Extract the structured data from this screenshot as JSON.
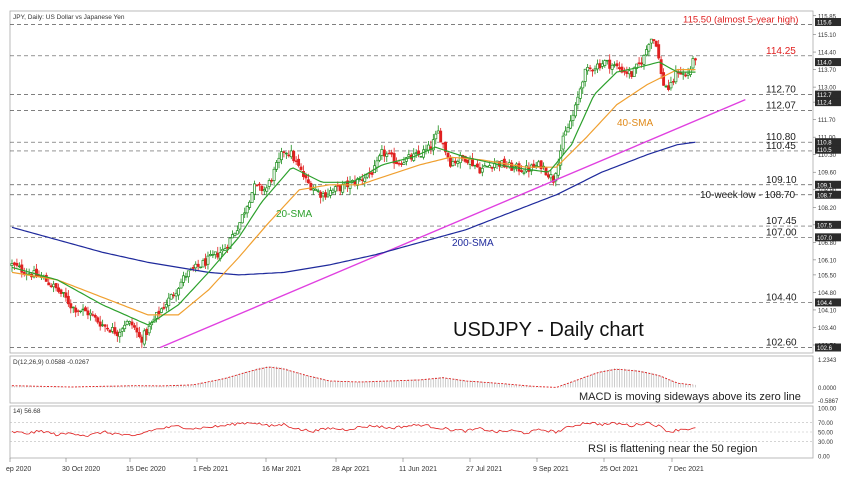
{
  "header": {
    "symbol_line": "JPY, Daily:  US Dollar vs Japanese Yen",
    "macd_line": "D(12,26,9) 0.0588 -0.0267",
    "rsi_line": "14) 56.68"
  },
  "annotations": {
    "main_title": "USDJPY - Daily chart",
    "sma20": "20-SMA",
    "sma40": "40-SMA",
    "sma200": "200-SMA",
    "high_label": "115.50 (almost 5-year high)",
    "low_label": "10-week low - 108.70",
    "macd_note": "MACD is moving sideways above its zero line",
    "rsi_note": "RSI is flattening near the 50 region"
  },
  "colors": {
    "up_candle": "#1a8c1a",
    "down_candle": "#e02020",
    "sma20": "#2ca02c",
    "sma40": "#f0a030",
    "sma200": "#1f2a9c",
    "trendline": "#e040e0",
    "level_highlight": "#e02020",
    "macd": "#e02020",
    "rsi": "#e02020"
  },
  "chart_data": {
    "type": "line",
    "title": "USDJPY - Daily chart",
    "x_tick_labels": [
      "ep 2020",
      "30 Oct 2020",
      "15 Dec 2020",
      "1 Feb 2021",
      "16 Mar 2021",
      "28 Apr 2021",
      "11 Jun 2021",
      "27 Jul 2021",
      "9 Sep 2021",
      "25 Oct 2021",
      "7 Dec 2021"
    ],
    "y_tick_labels": [
      "115.85",
      "115.10",
      "114.40",
      "113.70",
      "113.00",
      "112.40",
      "111.70",
      "111.00",
      "110.30",
      "109.60",
      "108.90",
      "108.20",
      "107.50",
      "106.80",
      "106.10",
      "105.50",
      "104.80",
      "104.10",
      "103.40",
      "102.70"
    ],
    "ylim": [
      102.5,
      116.0
    ],
    "support_resistance": [
      {
        "value": 115.5,
        "label": "115.50 (almost 5-year high)",
        "highlight": true
      },
      {
        "value": 114.25,
        "label": "114.25",
        "highlight": true
      },
      {
        "value": 112.7,
        "label": "112.70",
        "highlight": false
      },
      {
        "value": 112.07,
        "label": "112.07",
        "highlight": false
      },
      {
        "value": 110.8,
        "label": "110.80",
        "highlight": false
      },
      {
        "value": 110.45,
        "label": "110.45",
        "highlight": false
      },
      {
        "value": 109.1,
        "label": "109.10",
        "highlight": false
      },
      {
        "value": 108.7,
        "label": "",
        "highlight": false
      },
      {
        "value": 107.45,
        "label": "107.45",
        "highlight": false
      },
      {
        "value": 107.0,
        "label": "107.00",
        "highlight": false
      },
      {
        "value": 104.4,
        "label": "104.40",
        "highlight": false
      },
      {
        "value": 102.6,
        "label": "102.60",
        "highlight": false
      }
    ],
    "right_axis_tags": [
      "115.6",
      "114.0",
      "112.7",
      "112.4",
      "110.8",
      "110.5",
      "109.1",
      "108.7",
      "107.5",
      "107.0",
      "104.4",
      "102.6"
    ],
    "price_keypoints": [
      [
        0,
        105.9
      ],
      [
        10,
        105.6
      ],
      [
        20,
        105.4
      ],
      [
        30,
        104.9
      ],
      [
        35,
        104.6
      ],
      [
        40,
        104.2
      ],
      [
        50,
        104.0
      ],
      [
        60,
        103.5
      ],
      [
        70,
        103.2
      ],
      [
        75,
        103.6
      ],
      [
        80,
        103.5
      ],
      [
        85,
        102.9
      ],
      [
        90,
        103.3
      ],
      [
        97,
        104.0
      ],
      [
        105,
        104.6
      ],
      [
        115,
        105.5
      ],
      [
        125,
        105.9
      ],
      [
        140,
        106.5
      ],
      [
        150,
        107.5
      ],
      [
        160,
        109.0
      ],
      [
        168,
        108.9
      ],
      [
        180,
        110.5
      ],
      [
        185,
        110.3
      ],
      [
        195,
        109.2
      ],
      [
        205,
        108.7
      ],
      [
        218,
        109.0
      ],
      [
        230,
        109.3
      ],
      [
        240,
        109.7
      ],
      [
        245,
        110.4
      ],
      [
        255,
        110.0
      ],
      [
        265,
        110.2
      ],
      [
        270,
        110.3
      ],
      [
        277,
        110.6
      ],
      [
        282,
        111.2
      ],
      [
        290,
        110.0
      ],
      [
        300,
        110.2
      ],
      [
        310,
        109.7
      ],
      [
        320,
        110.0
      ],
      [
        330,
        109.8
      ],
      [
        340,
        109.7
      ],
      [
        350,
        109.9
      ],
      [
        358,
        109.3
      ],
      [
        365,
        111.0
      ],
      [
        372,
        112.0
      ],
      [
        378,
        113.5
      ],
      [
        384,
        113.8
      ],
      [
        392,
        114.0
      ],
      [
        400,
        113.8
      ],
      [
        410,
        113.5
      ],
      [
        418,
        114.2
      ],
      [
        422,
        115.0
      ],
      [
        426,
        114.8
      ],
      [
        430,
        113.2
      ],
      [
        435,
        112.9
      ],
      [
        440,
        113.7
      ],
      [
        446,
        113.4
      ],
      [
        452,
        114.2
      ]
    ],
    "sma20_keypoints": [
      [
        0,
        105.8
      ],
      [
        30,
        105.3
      ],
      [
        60,
        104.3
      ],
      [
        90,
        103.5
      ],
      [
        110,
        104.3
      ],
      [
        130,
        105.6
      ],
      [
        150,
        107.0
      ],
      [
        165,
        108.4
      ],
      [
        185,
        109.8
      ],
      [
        205,
        109.2
      ],
      [
        225,
        109.2
      ],
      [
        245,
        109.9
      ],
      [
        265,
        110.2
      ],
      [
        280,
        110.6
      ],
      [
        300,
        110.2
      ],
      [
        330,
        109.8
      ],
      [
        355,
        109.6
      ],
      [
        370,
        110.7
      ],
      [
        385,
        112.7
      ],
      [
        400,
        113.6
      ],
      [
        415,
        113.8
      ],
      [
        428,
        114.0
      ],
      [
        440,
        113.6
      ],
      [
        452,
        113.6
      ]
    ],
    "sma40_keypoints": [
      [
        0,
        105.6
      ],
      [
        30,
        105.3
      ],
      [
        60,
        104.6
      ],
      [
        90,
        103.9
      ],
      [
        110,
        103.9
      ],
      [
        130,
        104.9
      ],
      [
        150,
        106.2
      ],
      [
        170,
        107.6
      ],
      [
        190,
        108.9
      ],
      [
        210,
        109.1
      ],
      [
        230,
        109.1
      ],
      [
        250,
        109.5
      ],
      [
        270,
        109.9
      ],
      [
        290,
        110.2
      ],
      [
        310,
        110.1
      ],
      [
        340,
        109.8
      ],
      [
        360,
        109.8
      ],
      [
        380,
        111.0
      ],
      [
        400,
        112.3
      ],
      [
        420,
        113.1
      ],
      [
        440,
        113.7
      ],
      [
        452,
        113.7
      ]
    ],
    "sma200_keypoints": [
      [
        0,
        107.4
      ],
      [
        30,
        106.9
      ],
      [
        60,
        106.4
      ],
      [
        90,
        106.0
      ],
      [
        110,
        105.8
      ],
      [
        130,
        105.6
      ],
      [
        150,
        105.5
      ],
      [
        180,
        105.6
      ],
      [
        210,
        105.9
      ],
      [
        240,
        106.3
      ],
      [
        270,
        106.8
      ],
      [
        300,
        107.3
      ],
      [
        330,
        108.0
      ],
      [
        360,
        108.7
      ],
      [
        390,
        109.6
      ],
      [
        420,
        110.3
      ],
      [
        440,
        110.7
      ],
      [
        452,
        110.8
      ]
    ],
    "trendline": {
      "start": [
        98,
        102.6
      ],
      "end": [
        485,
        112.5
      ]
    },
    "macd_keypoints": [
      [
        0,
        0.08
      ],
      [
        20,
        0.05
      ],
      [
        40,
        0.02
      ],
      [
        60,
        0.05
      ],
      [
        80,
        0.08
      ],
      [
        100,
        0.07
      ],
      [
        120,
        0.12
      ],
      [
        140,
        0.4
      ],
      [
        160,
        0.8
      ],
      [
        170,
        0.95
      ],
      [
        180,
        0.85
      ],
      [
        195,
        0.55
      ],
      [
        210,
        0.3
      ],
      [
        230,
        0.25
      ],
      [
        250,
        0.3
      ],
      [
        270,
        0.35
      ],
      [
        285,
        0.45
      ],
      [
        300,
        0.3
      ],
      [
        320,
        0.2
      ],
      [
        345,
        0.05
      ],
      [
        360,
        0.0
      ],
      [
        372,
        0.3
      ],
      [
        388,
        0.7
      ],
      [
        400,
        0.85
      ],
      [
        415,
        0.75
      ],
      [
        428,
        0.55
      ],
      [
        440,
        0.2
      ],
      [
        452,
        0.1
      ]
    ],
    "macd_ylim": [
      -0.6,
      1.3
    ],
    "macd_tick_labels": [
      "1.2343",
      "0.0000",
      "-0.5867"
    ],
    "rsi_keypoints": [
      [
        0,
        50
      ],
      [
        10,
        47
      ],
      [
        20,
        52
      ],
      [
        30,
        44
      ],
      [
        40,
        48
      ],
      [
        50,
        42
      ],
      [
        60,
        50
      ],
      [
        70,
        46
      ],
      [
        80,
        40
      ],
      [
        90,
        52
      ],
      [
        100,
        58
      ],
      [
        110,
        62
      ],
      [
        120,
        57
      ],
      [
        130,
        60
      ],
      [
        140,
        63
      ],
      [
        150,
        68
      ],
      [
        160,
        70
      ],
      [
        170,
        62
      ],
      [
        180,
        66
      ],
      [
        190,
        55
      ],
      [
        200,
        52
      ],
      [
        210,
        58
      ],
      [
        220,
        55
      ],
      [
        230,
        60
      ],
      [
        240,
        63
      ],
      [
        250,
        58
      ],
      [
        260,
        62
      ],
      [
        270,
        65
      ],
      [
        280,
        60
      ],
      [
        290,
        55
      ],
      [
        300,
        52
      ],
      [
        310,
        57
      ],
      [
        320,
        50
      ],
      [
        330,
        53
      ],
      [
        340,
        48
      ],
      [
        350,
        55
      ],
      [
        360,
        50
      ],
      [
        370,
        62
      ],
      [
        380,
        70
      ],
      [
        390,
        66
      ],
      [
        400,
        68
      ],
      [
        410,
        63
      ],
      [
        420,
        70
      ],
      [
        428,
        62
      ],
      [
        435,
        50
      ],
      [
        442,
        56
      ],
      [
        452,
        57
      ]
    ],
    "rsi_ylim": [
      0,
      100
    ],
    "rsi_tick_labels": [
      "100.00",
      "70.00",
      "50.00",
      "30.00",
      "0.00"
    ]
  }
}
